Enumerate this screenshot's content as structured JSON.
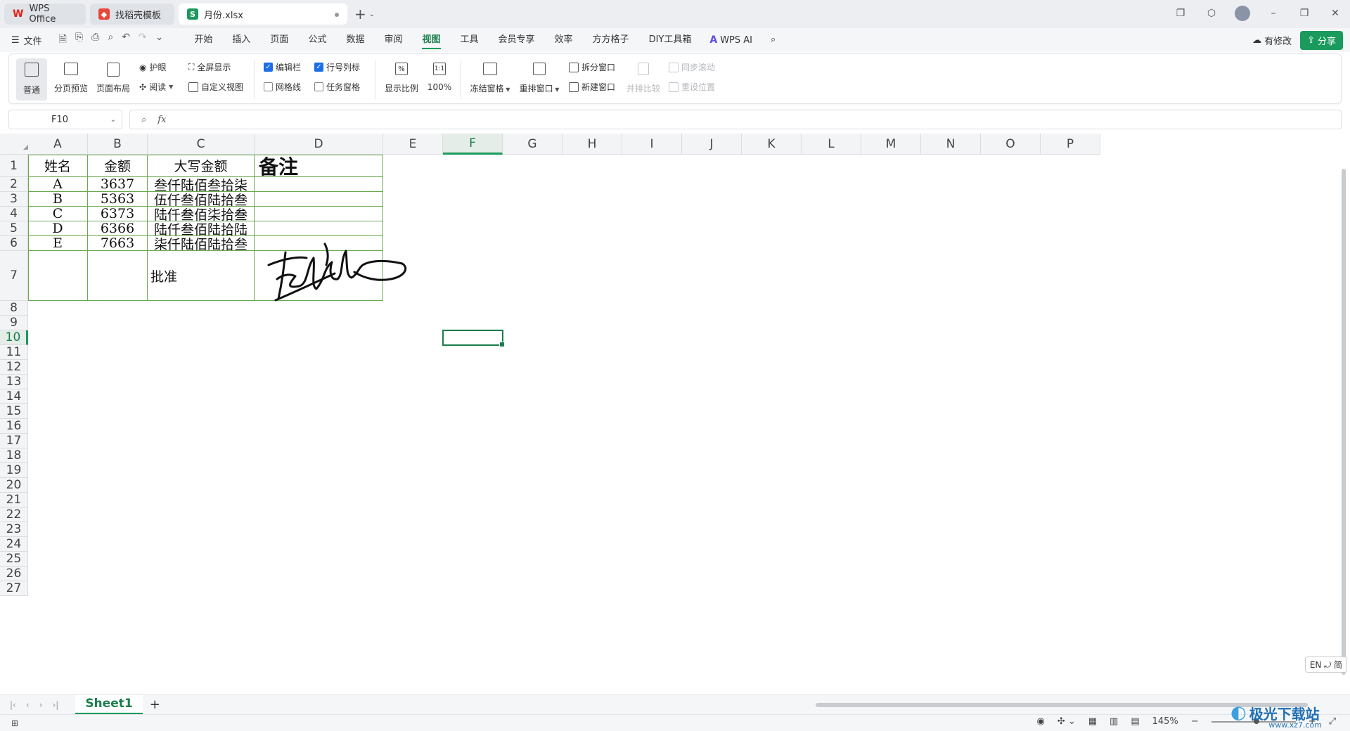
{
  "tabs": [
    {
      "label": "WPS Office",
      "icon": "wps-logo-icon"
    },
    {
      "label": "找稻壳模板",
      "icon": "daoke-logo-icon"
    },
    {
      "label": "月份.xlsx",
      "icon": "spreadsheet-logo-icon",
      "active": true
    }
  ],
  "menubar": {
    "file_label": "文件",
    "items": [
      "开始",
      "插入",
      "页面",
      "公式",
      "数据",
      "审阅",
      "视图",
      "工具",
      "会员专享",
      "效率",
      "方方格子",
      "DIY工具箱"
    ],
    "active": "视图",
    "wpsai_label": "WPS AI",
    "changes_label": "有修改",
    "share_label": "分享"
  },
  "ribbon": {
    "normal": "普通",
    "page_break": "分页预览",
    "page_layout": "页面布局",
    "eye_protect": "护眼",
    "reading": "阅读",
    "fullscreen": "全屏显示",
    "custom_view": "自定义视图",
    "edit_bar": "编辑栏",
    "row_col_headers": "行号列标",
    "gridlines": "网格线",
    "task_pane": "任务窗格",
    "zoom_ratio": "显示比例",
    "zoom_100": "100%",
    "freeze": "冻结窗格",
    "rearrange": "重排窗口",
    "split": "拆分窗口",
    "new_window": "新建窗口",
    "side_by_side": "并排比较",
    "sync_scroll": "同步滚动",
    "reset_position": "重设位置",
    "checks": {
      "edit_bar": true,
      "row_col_headers": true,
      "gridlines": false,
      "task_pane": false
    }
  },
  "formula_bar": {
    "name_box": "F10",
    "fx_label": "fx",
    "formula": ""
  },
  "columns": [
    "A",
    "B",
    "C",
    "D",
    "E",
    "F",
    "G",
    "H",
    "I",
    "J",
    "K",
    "L",
    "M",
    "N",
    "O",
    "P"
  ],
  "selected_column": "F",
  "rows": [
    "1",
    "2",
    "3",
    "4",
    "5",
    "6",
    "7",
    "8",
    "9",
    "10",
    "11",
    "12",
    "13",
    "14",
    "15",
    "16",
    "17",
    "18",
    "19",
    "20",
    "21",
    "22",
    "23",
    "24",
    "25",
    "26",
    "27"
  ],
  "selected_row": "10",
  "table": {
    "headers": [
      "姓名",
      "金额",
      "大写金额",
      "备注"
    ],
    "data": [
      [
        "A",
        "3637",
        "叁仟陆佰叁拾柒",
        ""
      ],
      [
        "B",
        "5363",
        "伍仟叁佰陆拾叁",
        ""
      ],
      [
        "C",
        "6373",
        "陆仟叁佰柒拾叁",
        ""
      ],
      [
        "D",
        "6366",
        "陆仟叁佰陆拾陆",
        ""
      ],
      [
        "E",
        "7663",
        "柒仟陆佰陆拾叁",
        ""
      ]
    ],
    "approval_label": "批准"
  },
  "sheets": [
    {
      "name": "Sheet1",
      "active": true
    }
  ],
  "ime_badge": "EN ⤾ 简",
  "status": {
    "zoom": "145%"
  },
  "watermark": {
    "text": "极光下载站",
    "sub": "www.xz7.com"
  },
  "colors": {
    "accent": "#1a9a5c",
    "cell_border": "#6aa84f",
    "selection": "#1a7e4b"
  }
}
